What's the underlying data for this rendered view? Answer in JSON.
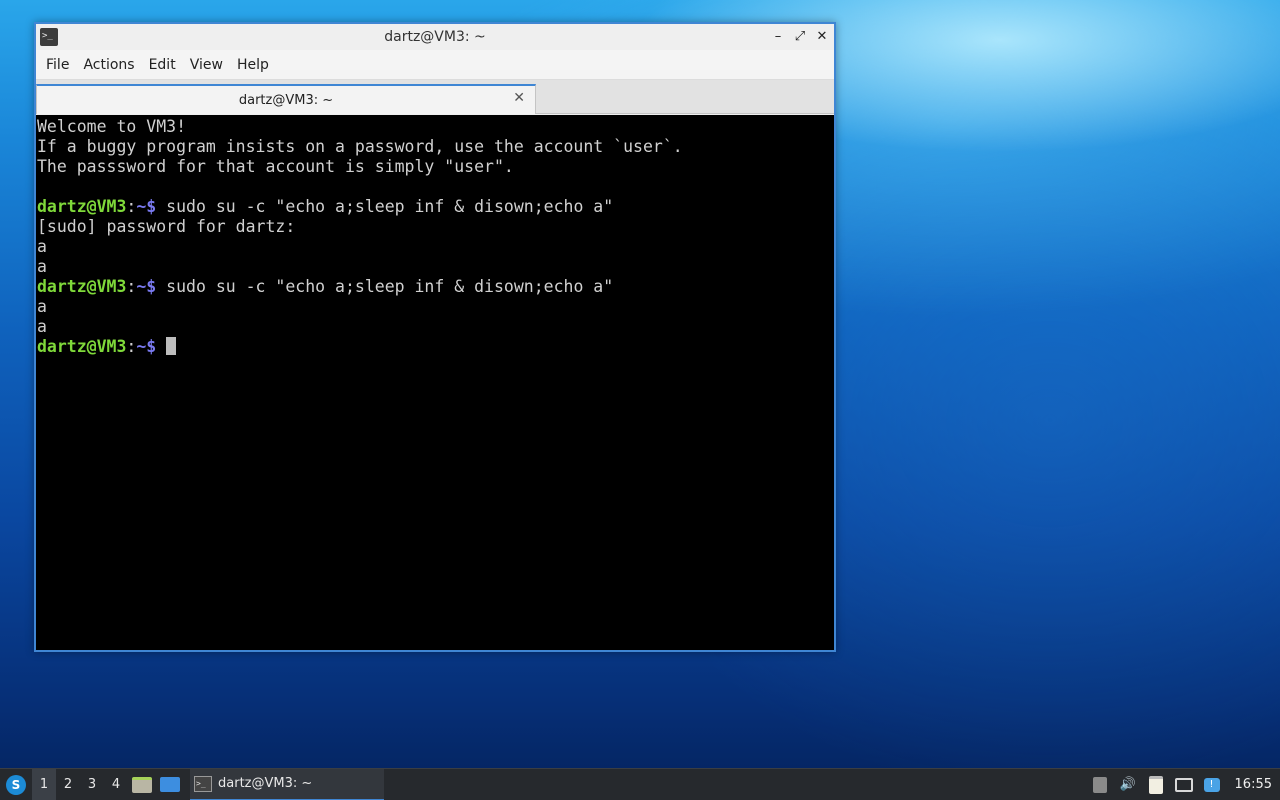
{
  "window": {
    "title": "dartz@VM3: ~",
    "controls": {
      "minimize": "–",
      "maximize": "⤢",
      "close": "✕"
    },
    "app_icon_glyph": ">_"
  },
  "menubar": {
    "items": [
      "File",
      "Actions",
      "Edit",
      "View",
      "Help"
    ]
  },
  "tab": {
    "label": "dartz@VM3: ~",
    "close": "✕"
  },
  "terminal": {
    "prompt_user": "dartz@VM3",
    "prompt_sep": ":",
    "prompt_path": "~$",
    "lines": [
      "Welcome to VM3!",
      "If a buggy program insists on a password, use the account `user`.",
      "The passsword for that account is simply \"user\".",
      "",
      "",
      "[sudo] password for dartz:",
      "a",
      "a",
      "",
      "a",
      "a"
    ],
    "commands": [
      " sudo su -c \"echo a;sleep inf & disown;echo a\"",
      " sudo su -c \"echo a;sleep inf & disown;echo a\"",
      " "
    ]
  },
  "taskbar": {
    "menu_glyph": "S",
    "desktops": [
      "1",
      "2",
      "3",
      "4"
    ],
    "active_desktop": "1",
    "task_label": "dartz@VM3: ~",
    "task_icon_glyph": ">_",
    "volume_glyph": "🔊",
    "update_glyph": "!",
    "clock": "16:55"
  },
  "colors": {
    "prompt_user": "#7fd93a",
    "prompt_path": "#7a7af0",
    "accent": "#3f86d4"
  }
}
